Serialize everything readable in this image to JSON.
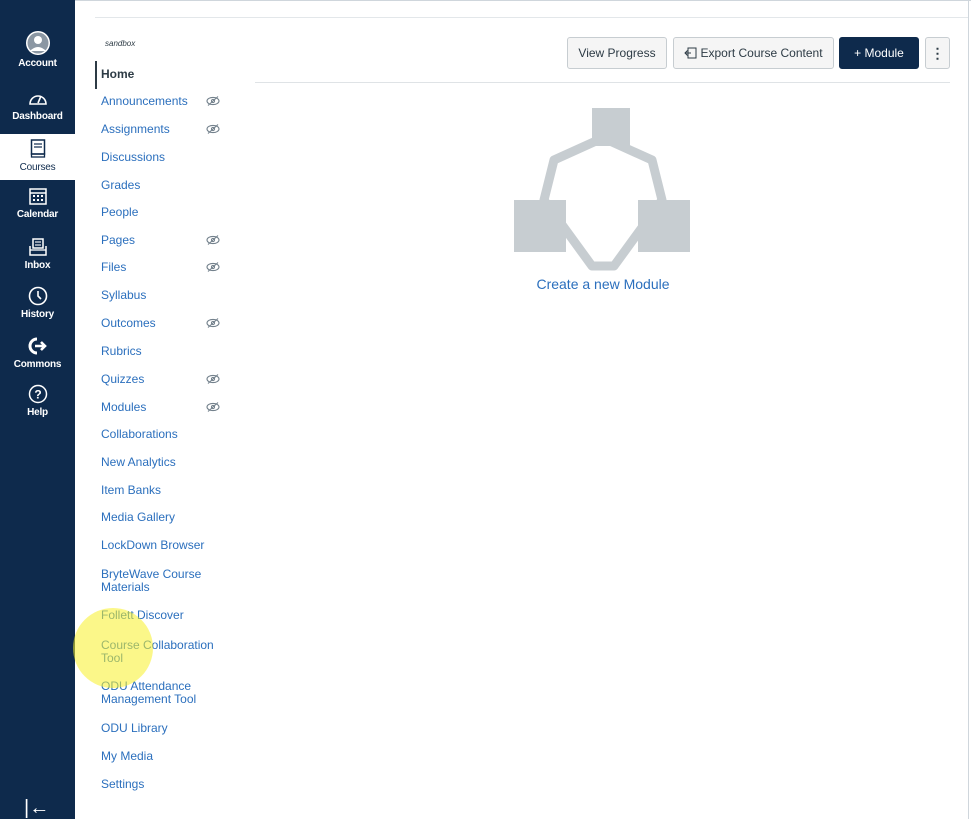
{
  "global_nav": {
    "items": [
      {
        "label": "Account",
        "icon": "account-avatar-icon"
      },
      {
        "label": "Dashboard",
        "icon": "dashboard-icon"
      },
      {
        "label": "Courses",
        "icon": "courses-icon",
        "active": true
      },
      {
        "label": "Calendar",
        "icon": "calendar-icon"
      },
      {
        "label": "Inbox",
        "icon": "inbox-icon"
      },
      {
        "label": "History",
        "icon": "history-clock-icon"
      },
      {
        "label": "Commons",
        "icon": "commons-icon"
      },
      {
        "label": "Help",
        "icon": "help-icon"
      }
    ],
    "collapse_glyph": "|←"
  },
  "course_nav": {
    "term": "sandbox",
    "home": "Home",
    "links": [
      {
        "label": "Announcements",
        "hidden": true
      },
      {
        "label": "Assignments",
        "hidden": true
      },
      {
        "label": "Discussions",
        "hidden": false
      },
      {
        "label": "Grades",
        "hidden": false
      },
      {
        "label": "People",
        "hidden": false
      },
      {
        "label": "Pages",
        "hidden": true
      },
      {
        "label": "Files",
        "hidden": true
      },
      {
        "label": "Syllabus",
        "hidden": false
      },
      {
        "label": "Outcomes",
        "hidden": true
      },
      {
        "label": "Rubrics",
        "hidden": false
      },
      {
        "label": "Quizzes",
        "hidden": true
      },
      {
        "label": "Modules",
        "hidden": true
      },
      {
        "label": "Collaborations",
        "hidden": false
      },
      {
        "label": "New Analytics",
        "hidden": false
      },
      {
        "label": "Item Banks",
        "hidden": false
      },
      {
        "label": "Media Gallery",
        "hidden": false
      },
      {
        "label": "LockDown Browser",
        "hidden": false
      },
      {
        "label": "BryteWave Course Materials",
        "hidden": false
      },
      {
        "label": "Follett Discover",
        "hidden": false
      },
      {
        "label": "Course Collaboration Tool",
        "hidden": false
      },
      {
        "label": "ODU Attendance Management Tool",
        "hidden": false
      },
      {
        "label": "ODU Library",
        "hidden": false
      },
      {
        "label": "My Media",
        "hidden": false
      },
      {
        "label": "Settings",
        "hidden": false
      }
    ]
  },
  "toolbar": {
    "view_progress": "View Progress",
    "export": "Export Course Content",
    "add_module": "+ Module",
    "more": "⋮"
  },
  "empty_state": {
    "label": "Create a new Module"
  },
  "colors": {
    "nav_bg": "#0e2a4c",
    "link": "#2b6fbd",
    "illustration": "#c7cdd1"
  }
}
